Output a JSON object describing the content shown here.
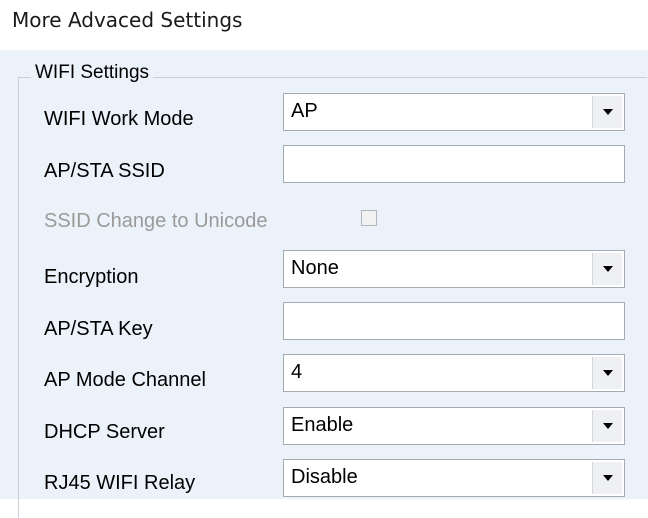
{
  "header": {
    "title": "More Advaced Settings"
  },
  "group": {
    "title": "WIFI Settings"
  },
  "rows": {
    "work_mode": {
      "label": "WIFI Work Mode",
      "value": "AP"
    },
    "ssid": {
      "label": "AP/STA SSID",
      "value": ""
    },
    "unicode": {
      "label": "SSID Change to Unicode",
      "checked": false,
      "enabled": false
    },
    "encryption": {
      "label": "Encryption",
      "value": "None"
    },
    "key": {
      "label": "AP/STA Key",
      "value": ""
    },
    "channel": {
      "label": "AP Mode Channel",
      "value": "4"
    },
    "dhcp": {
      "label": "DHCP Server",
      "value": "Enable"
    },
    "relay": {
      "label": "RJ45 WIFI Relay",
      "value": "Disable"
    }
  },
  "icons": {
    "dropdown": "chevron-down-icon"
  },
  "colors": {
    "panel_bg": "#ecf2f9",
    "disabled_text": "#9a9a9a",
    "field_border": "#a3abb3"
  }
}
